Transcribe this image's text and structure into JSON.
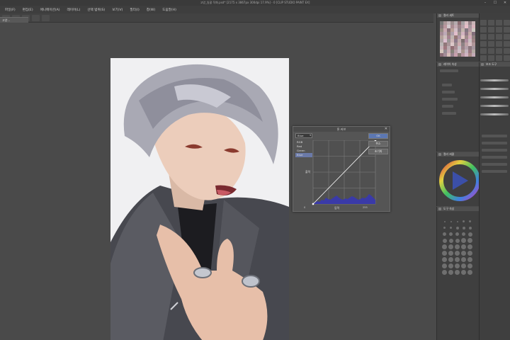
{
  "window": {
    "title": "고양_일괄 작화.psd* [2175 x 3867px 300dpi 17.9%] - 0 [CLIP STUDIO PAINT EX]",
    "minimize": "–",
    "maximize": "☐",
    "close": "✕"
  },
  "menu": {
    "items": [
      {
        "label": "파일(F)"
      },
      {
        "label": "편집(E)"
      },
      {
        "label": "애니메이션(A)"
      },
      {
        "label": "레이어(L)"
      },
      {
        "label": "선택 범위(S)"
      },
      {
        "label": "보기(V)"
      },
      {
        "label": "필터(I)"
      },
      {
        "label": "창(W)"
      },
      {
        "label": "도움말(H)"
      }
    ]
  },
  "document_tab": {
    "label": "고양..."
  },
  "tone_curve_dialog": {
    "title": "톤 커브",
    "close": "✕",
    "channel_selected": "Blue",
    "channels": [
      {
        "label": "RGB",
        "selected": false
      },
      {
        "label": "Red",
        "selected": false
      },
      {
        "label": "Green",
        "selected": false
      },
      {
        "label": "Blue",
        "selected": true
      }
    ],
    "output_label": "출력",
    "input_label": "입력",
    "axis_min": "0",
    "axis_max": "255",
    "ok_label": "OK",
    "cancel_label": "취소",
    "reset_label": "초기화",
    "curve_color": "#ffffff",
    "histogram_color": "#3a3aa8"
  },
  "panels": {
    "color_set_title": "컬러 세트",
    "sub_tool_title": "보조 도구",
    "layer_property_title": "레이어 속성",
    "color_wheel_title": "컬러 써클",
    "tool_property_title": "도구 속성",
    "accent": "#5c77b2"
  }
}
